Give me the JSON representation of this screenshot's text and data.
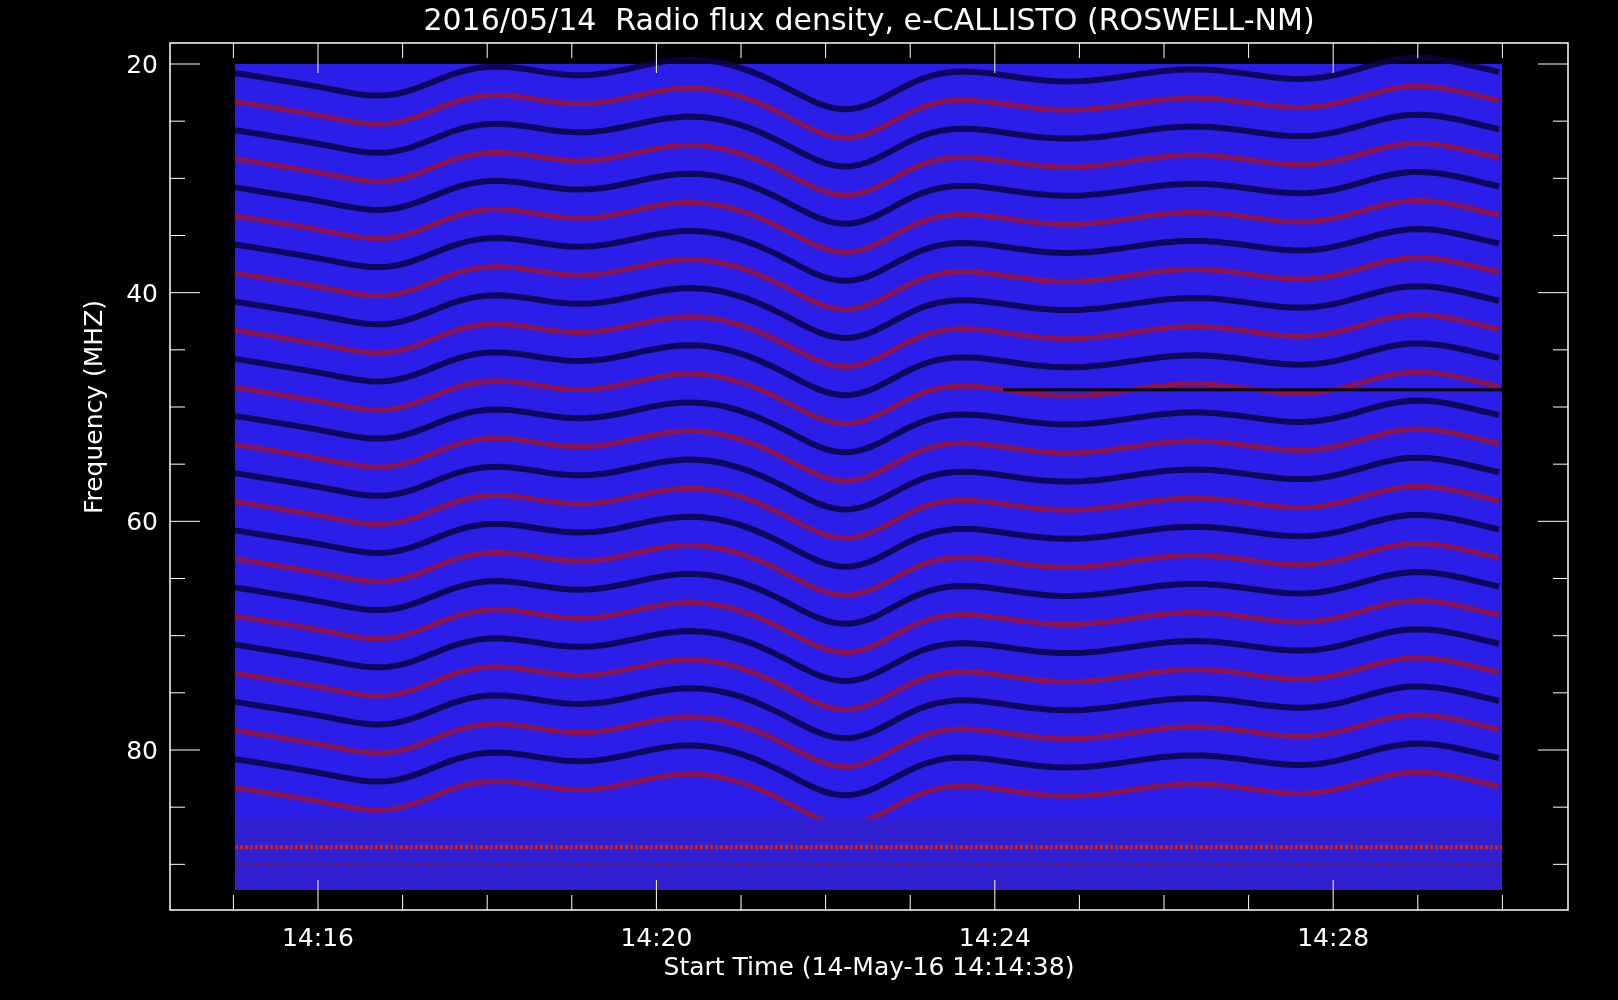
{
  "title": "2016/05/14  Radio flux density, e-CALLISTO (ROSWELL-NM)",
  "plot": {
    "ylabel": "Frequency (MHZ)",
    "xlabel": "Start Time (14-May-16 14:14:38)",
    "yticks": [
      "20",
      "40",
      "60",
      "80"
    ],
    "xticks": [
      "14:16",
      "14:20",
      "14:24",
      "14:28"
    ]
  }
}
